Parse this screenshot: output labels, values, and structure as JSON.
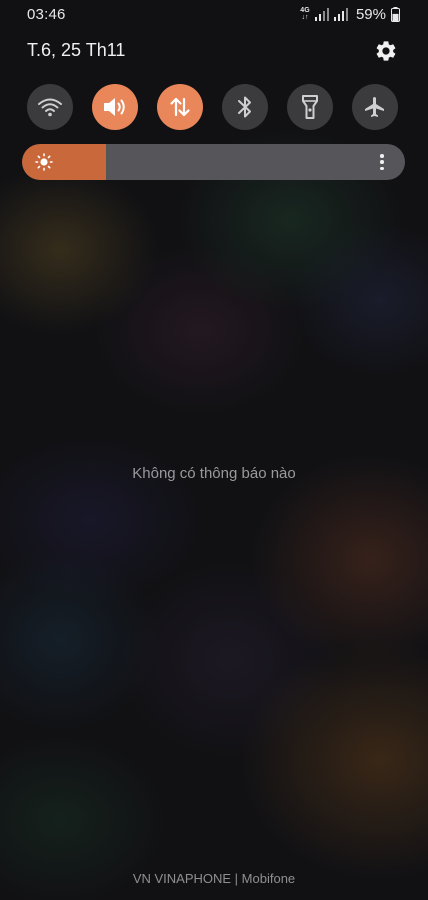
{
  "status_bar": {
    "time": "03:46",
    "network_type": "4G",
    "battery_percent": "59%",
    "battery_level": 0.59
  },
  "panel": {
    "date": "T.6, 25 Th11"
  },
  "quick_toggles": [
    {
      "name": "wifi",
      "on": false
    },
    {
      "name": "sound",
      "on": true
    },
    {
      "name": "mobile-data",
      "on": true
    },
    {
      "name": "bluetooth",
      "on": false
    },
    {
      "name": "flashlight",
      "on": false
    },
    {
      "name": "airplane-mode",
      "on": false
    }
  ],
  "brightness": {
    "level": 0.22
  },
  "notifications": {
    "empty_message": "Không có thông báo nào"
  },
  "footer": {
    "carrier_text": "VN VINAPHONE | Mobifone"
  },
  "colors": {
    "accent_on": "#e9875a",
    "brightness_fill": "#c9683a",
    "toggle_off": "#3b3b3e"
  }
}
